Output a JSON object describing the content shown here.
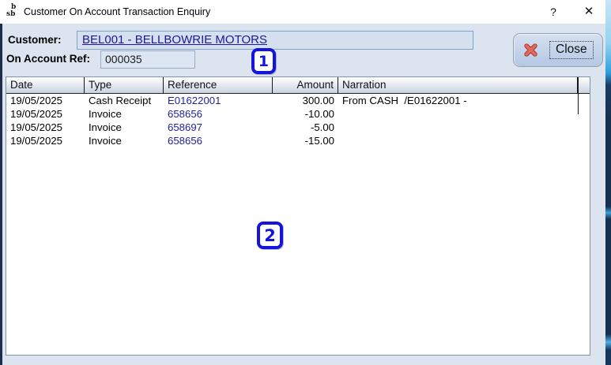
{
  "window": {
    "title": "Customer On Account Transaction Enquiry",
    "icon_top": "b",
    "icon_bottom": "sb",
    "help_label": "?",
    "close_label": "✕"
  },
  "form": {
    "customer_label": "Customer:",
    "customer_value": "BEL001 - BELLBOWRIE MOTORS",
    "on_account_ref_label": "On Account Ref:",
    "on_account_ref_value": "000035"
  },
  "close_button": {
    "label": "Close",
    "icon": "red-x-icon"
  },
  "table": {
    "columns": [
      "Date",
      "Type",
      "Reference",
      "Amount",
      "Narration"
    ],
    "rows": [
      {
        "date": "19/05/2025",
        "type": "Cash Receipt",
        "reference": "E01622001",
        "amount": "300.00",
        "narration": "From CASH  /E01622001 -"
      },
      {
        "date": "19/05/2025",
        "type": "Invoice",
        "reference": "658656",
        "amount": "-10.00",
        "narration": ""
      },
      {
        "date": "19/05/2025",
        "type": "Invoice",
        "reference": "658697",
        "amount": "-5.00",
        "narration": ""
      },
      {
        "date": "19/05/2025",
        "type": "Invoice",
        "reference": "658656",
        "amount": "-15.00",
        "narration": ""
      }
    ]
  },
  "annotations": [
    {
      "label": "1"
    },
    {
      "label": "2"
    }
  ],
  "colors": {
    "dialog_bg": "#dce4f0",
    "titlebar_bg": "#ffffff",
    "link_navy": "#1b1b96",
    "reference_navy": "#2121a0",
    "annotation_blue": "#1414dc",
    "close_x_red": "#dd4b3e",
    "header_gradient_bottom": "#cbd3df",
    "window_edge_navy": "#16304f"
  }
}
